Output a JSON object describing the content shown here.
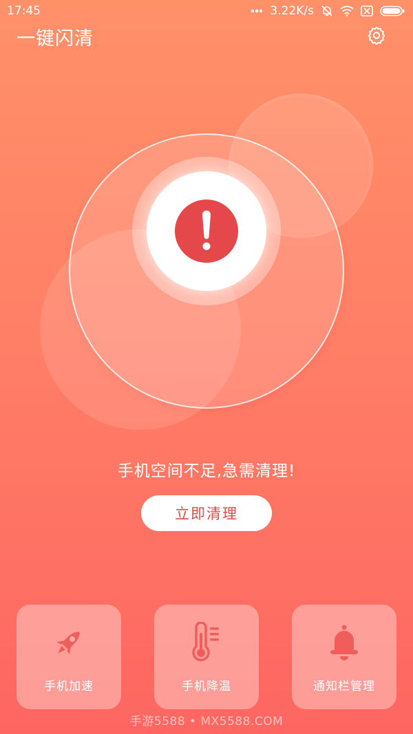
{
  "status_bar": {
    "time": "17:45",
    "net_speed": "3.22K/s",
    "icons": [
      "more-dots-icon",
      "mute-bell-icon",
      "wifi-icon",
      "sim-off-icon",
      "battery-icon"
    ]
  },
  "header": {
    "title": "一键闪清",
    "settings_icon": "gear-icon"
  },
  "status": {
    "alert_icon": "exclamation-icon",
    "message": "手机空间不足,急需清理!",
    "clean_button": "立即清理"
  },
  "tools": [
    {
      "label": "手机加速",
      "icon": "rocket-icon"
    },
    {
      "label": "手机降温",
      "icon": "thermometer-icon"
    },
    {
      "label": "通知栏管理",
      "icon": "bell-icon"
    }
  ],
  "watermark": "手游5588 • MX5588.COM",
  "colors": {
    "gradient_top": "#ff9169",
    "gradient_bottom": "#fe6662",
    "alert_red": "#e5484b",
    "button_text": "#e3484a",
    "icon_tint": "#f05e5c"
  }
}
